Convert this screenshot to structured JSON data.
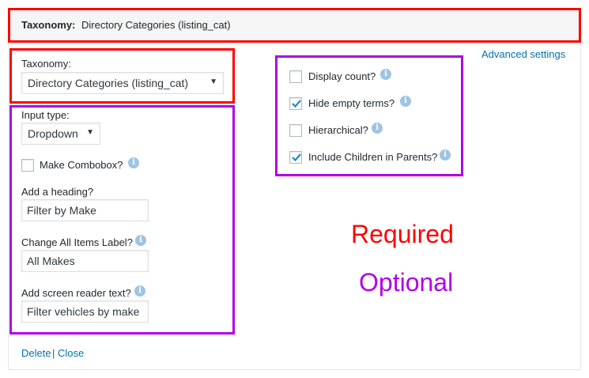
{
  "header": {
    "label": "Taxonomy:",
    "value": "Directory Categories (listing_cat)"
  },
  "taxonomy": {
    "label": "Taxonomy:",
    "selected": "Directory Categories (listing_cat)"
  },
  "input_type": {
    "label": "Input type:",
    "selected": "Dropdown"
  },
  "combobox": {
    "label": "Make Combobox?",
    "checked": false
  },
  "heading": {
    "label": "Add a heading?",
    "value": "Filter by Make"
  },
  "all_items": {
    "label": "Change All Items Label?",
    "value": "All Makes"
  },
  "screen_reader": {
    "label": "Add screen reader text?",
    "value": "Filter vehicles by make"
  },
  "advanced_link": "Advanced settings",
  "options": [
    {
      "label": "Display count?",
      "checked": false
    },
    {
      "label": "Hide empty terms?",
      "checked": true
    },
    {
      "label": "Hierarchical?",
      "checked": false
    },
    {
      "label": "Include Children in Parents?",
      "checked": true
    }
  ],
  "footer": {
    "delete": "Delete",
    "separator": "|",
    "close": "Close"
  },
  "legend": {
    "required": "Required",
    "optional": "Optional"
  },
  "colors": {
    "required": "#ff0000",
    "optional": "#b000e8",
    "link": "#0073aa",
    "check": "#1e8cbe"
  },
  "icons": {
    "info": "info-icon",
    "check": "checkmark-icon",
    "dropdown": "caret-down-icon"
  }
}
